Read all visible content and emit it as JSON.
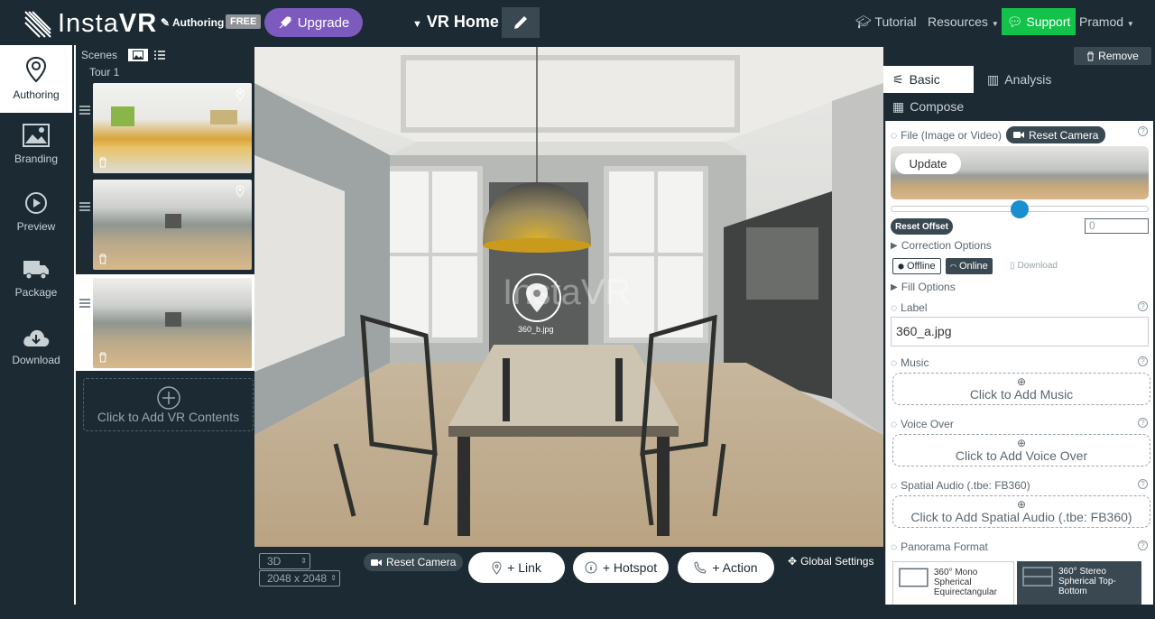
{
  "topbar": {
    "logo_text_light": "Insta",
    "logo_text_bold": "VR",
    "authoring_label": "Authoring",
    "plan_badge": "FREE",
    "upgrade_label": "Upgrade",
    "project_title": "VR Home",
    "tutorial_label": "Tutorial",
    "resources_label": "Resources",
    "support_label": "Support",
    "user_label": "Pramod"
  },
  "leftnav": {
    "items": [
      {
        "label": "Authoring",
        "icon": "map-pin-icon",
        "active": true
      },
      {
        "label": "Branding",
        "icon": "image-icon",
        "active": false
      },
      {
        "label": "Preview",
        "icon": "play-circle-icon",
        "active": false
      },
      {
        "label": "Package",
        "icon": "truck-icon",
        "active": false
      },
      {
        "label": "Download",
        "icon": "cloud-download-icon",
        "active": false
      }
    ]
  },
  "scenes": {
    "header": "Scenes",
    "tour_label": "Tour 1",
    "add_label": "Click to Add VR Contents"
  },
  "viewer": {
    "watermark": "InstaVR",
    "hotspot_caption": "360_b.jpg",
    "mode_select": "3D",
    "resolution_select": "2048 x 2048",
    "reset_camera_label": "Reset Camera",
    "link_label": "+ Link",
    "hotspot_label": "+ Hotspot",
    "action_label": "+ Action",
    "global_settings_label": "Global Settings"
  },
  "rightpanel": {
    "remove_label": "Remove",
    "tabs": {
      "basic": "Basic",
      "analysis": "Analysis",
      "compose": "Compose"
    },
    "file_label": "File (Image or Video)",
    "reset_camera_label": "Reset Camera",
    "update_label": "Update",
    "slider_value": 0.5,
    "reset_offset_label": "Reset Offset",
    "offset_value": "0",
    "correction_options_label": "Correction Options",
    "offline_label": "Offline",
    "online_label": "Online",
    "download_label": "Download",
    "fill_options_label": "Fill Options",
    "label_label": "Label",
    "label_value": "360_a.jpg",
    "music_label": "Music",
    "music_add": "Click to Add Music",
    "voice_label": "Voice Over",
    "voice_add": "Click to Add Voice Over",
    "spatial_label": "Spatial Audio (.tbe: FB360)",
    "spatial_add": "Click to Add Spatial Audio (.tbe: FB360)",
    "panorama_label": "Panorama Format",
    "format_mono": "360° Mono Spherical Equirectangular",
    "format_stereo": "360° Stereo Spherical Top-Bottom"
  },
  "colors": {
    "bg": "#1c2a33",
    "upgrade": "#7d5bbe",
    "support": "#12c24a",
    "slider": "#1a8fd0"
  }
}
